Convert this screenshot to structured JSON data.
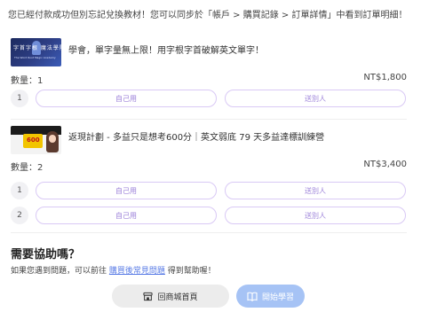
{
  "notice": {
    "text": "您已經付款成功但別忘記兌換教材！您可以同步於「帳戶 > 購買記錄 > 訂單詳情」中看到訂單明細！"
  },
  "products": [
    {
      "thumb_title": "字首字根 魔法學院",
      "thumb_subtitle": "The Word Root Magic Academy",
      "name": "學會，單字量無上限！用字根字首破解英文單字！",
      "quantity": "數量：1",
      "price": "NT$1,800",
      "rows": [
        {
          "num": "1",
          "self_label": "自己用",
          "gift_label": "送別人"
        }
      ]
    },
    {
      "thumb_badge": "600",
      "name": "返現計劃 - 多益只是想考600分｜英文弱底 79 天多益達標訓練營",
      "quantity": "數量：2",
      "price": "NT$3,400",
      "rows": [
        {
          "num": "1",
          "self_label": "自己用",
          "gift_label": "送別人"
        },
        {
          "num": "2",
          "self_label": "自己用",
          "gift_label": "送別人"
        }
      ]
    }
  ],
  "help": {
    "title": "需要協助嗎？",
    "text_before": "如果您遇到問題，可以前往 ",
    "link": "購買後常見問題",
    "text_after": " 得到幫助喔！"
  },
  "buttons": {
    "home": {
      "label": "回商城首頁",
      "icon": "store-icon"
    },
    "learn": {
      "label": "開始學習",
      "icon": "book-icon"
    }
  },
  "colors": {
    "accent_border": "#d9c9f5",
    "accent_text": "#9b80d9",
    "link": "#5b7de6",
    "primary_button": "#a6c3f5"
  }
}
